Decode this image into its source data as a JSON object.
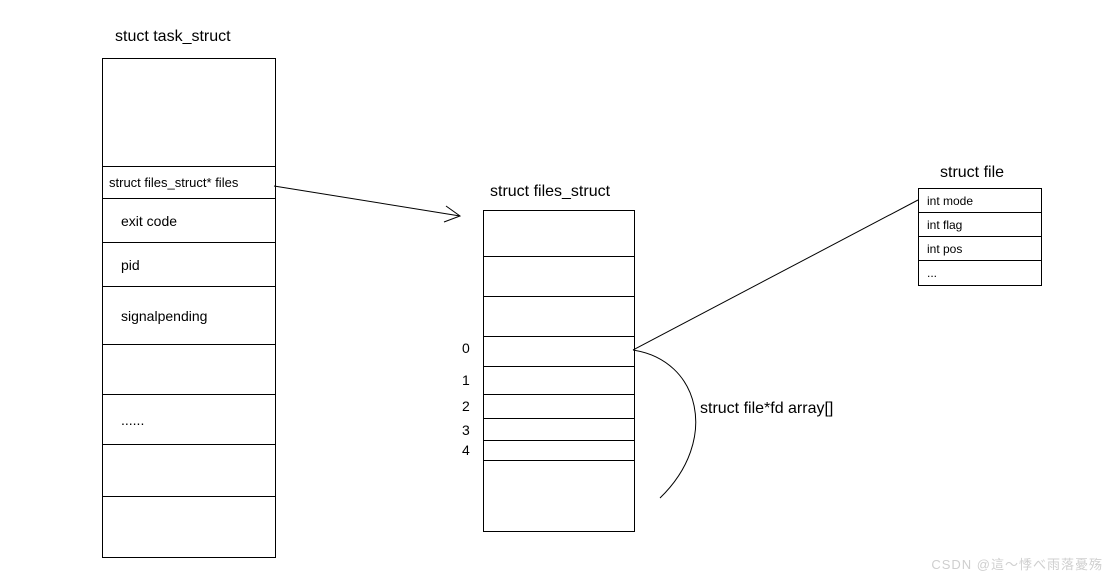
{
  "titles": {
    "task_struct": "stuct task_struct",
    "files_struct": "struct files_struct",
    "file": "struct file"
  },
  "task_struct_fields": {
    "files_ptr": "struct files_struct* files",
    "exit_code": "exit code",
    "pid": "pid",
    "signalpending": "signalpending",
    "etc": "......"
  },
  "fd_indices": {
    "i0": "0",
    "i1": "1",
    "i2": "2",
    "i3": "3",
    "i4": "4"
  },
  "fd_array_label": "struct file*fd array[]",
  "file_fields": {
    "mode": "int mode",
    "flag": "int flag",
    "pos": "int pos",
    "etc": "..."
  },
  "watermark": "CSDN @這～悸べ雨落憂殇"
}
